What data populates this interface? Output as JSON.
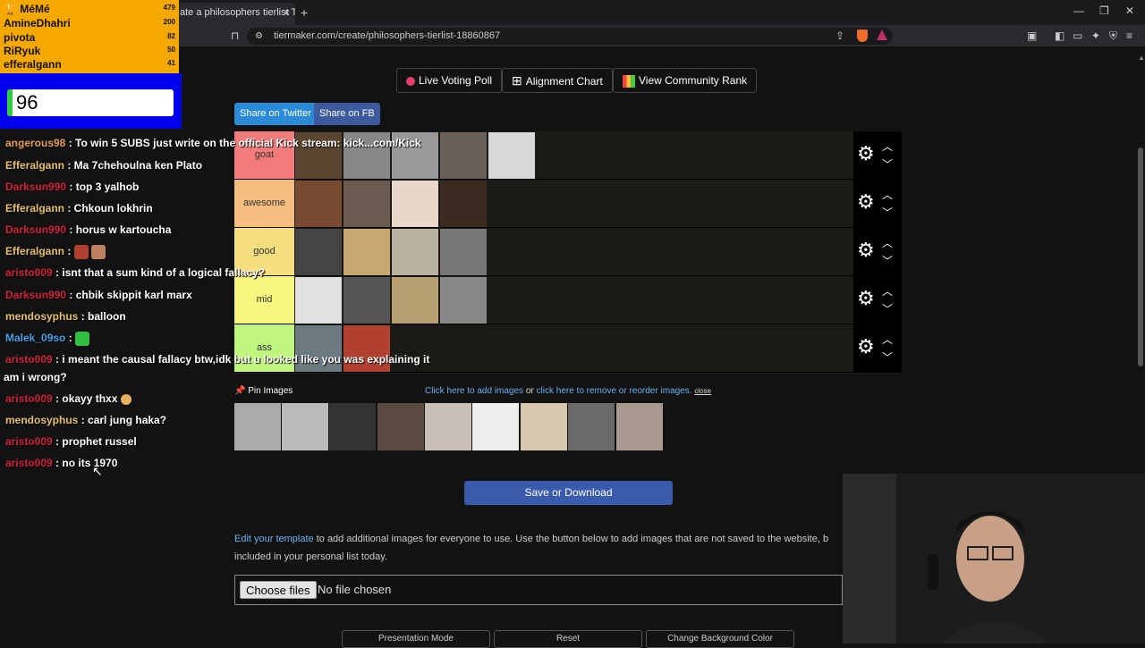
{
  "browser": {
    "tab_title": "ate a philosophers tierlist Tie",
    "tab_close": "×",
    "new_tab": "+",
    "url": "tiermaker.com/create/philosophers-tierlist-18860867",
    "window_controls": [
      "—",
      "❐",
      "✕"
    ]
  },
  "top_buttons": {
    "live_voting": "Live Voting Poll",
    "alignment_chart": "Alignment Chart",
    "community_rank": "View Community Rank"
  },
  "share": {
    "twitter": "Share on Twitter",
    "fb": "Share on FB"
  },
  "tiers": [
    {
      "label": "goat",
      "color": "#f27c7c",
      "images": 5
    },
    {
      "label": "awesome",
      "color": "#f5bd7f",
      "images": 4
    },
    {
      "label": "good",
      "color": "#f7df80",
      "images": 4
    },
    {
      "label": "mid",
      "color": "#f7f77f",
      "images": 4
    },
    {
      "label": "ass",
      "color": "#bff57f",
      "images": 2
    }
  ],
  "pin": {
    "label": "Pin Images",
    "add_link": "Click here to add images",
    "or_text": "or",
    "remove_link": "click here to remove or reorder images.",
    "close": "close"
  },
  "save_button": "Save or Download",
  "template": {
    "link": "Edit your template",
    "text": " to add additional images for everyone to use. Use the button below to add images that are not saved to the website, b",
    "text2": "included in your personal list today."
  },
  "file": {
    "choose": "Choose files",
    "status": "No file chosen"
  },
  "bottom_buttons": [
    "Presentation Mode",
    "Reset",
    "Change Background Color"
  ],
  "leaderboard": {
    "title": "MéMé",
    "rows": [
      {
        "name": "MéMé",
        "score": "479"
      },
      {
        "name": "AmineDhahri",
        "score": "200"
      },
      {
        "name": "pivota",
        "score": "82"
      },
      {
        "name": "RiRyuk",
        "score": "50"
      },
      {
        "name": "efferalgann",
        "score": "41"
      }
    ]
  },
  "counter": "96",
  "chat": [
    {
      "user": "angerous98",
      "color": "#e8a050",
      "msg": " : To win 5 SUBS just write on the official Kick stream: kick...com/Kick"
    },
    {
      "user": "Efferalgann",
      "color": "#e8c06a",
      "msg": " : Ma 7chehoulna ken Plato"
    },
    {
      "user": "Darksun990",
      "color": "#d0243c",
      "msg": " : top 3 yalhob"
    },
    {
      "user": "Efferalgann",
      "color": "#e8c06a",
      "msg": " : Chkoun lokhrin"
    },
    {
      "user": "Darksun990",
      "color": "#d0243c",
      "msg": " : horus w kartoucha"
    },
    {
      "user": "Efferalgann",
      "color": "#e8c06a",
      "msg": " : "
    },
    {
      "user": "aristo009",
      "color": "#d0243c",
      "msg": " : isnt that a sum kind of a logical fallacy?"
    },
    {
      "user": "Darksun990",
      "color": "#d0243c",
      "msg": " : chbik skippit karl marx"
    },
    {
      "user": "mendosyphus",
      "color": "#e8c06a",
      "msg": " : balloon"
    },
    {
      "user": "Malek_09so",
      "color": "#4aa0e8",
      "msg": " : "
    },
    {
      "user": "aristo009",
      "color": "#d0243c",
      "msg": " : i meant the causal fallacy btw,idk but u looked like you was explaining it"
    },
    {
      "user": "",
      "color": "#fff",
      "msg": "am i wrong?"
    },
    {
      "user": "aristo009",
      "color": "#d0243c",
      "msg": " : okayy thxx"
    },
    {
      "user": "mendosyphus",
      "color": "#e8c06a",
      "msg": " : carl jung haka?"
    },
    {
      "user": "aristo009",
      "color": "#d0243c",
      "msg": " : prophet russel"
    },
    {
      "user": "aristo009",
      "color": "#d0243c",
      "msg": " : no its 1970"
    }
  ]
}
